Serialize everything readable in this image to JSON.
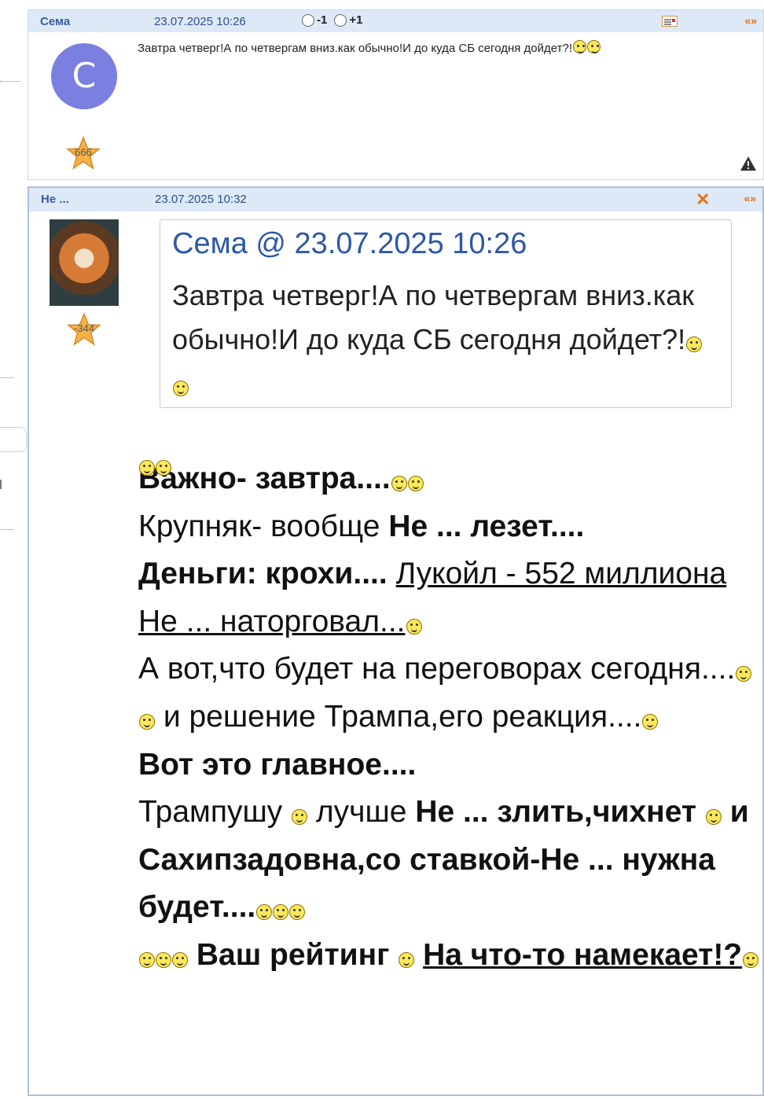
{
  "post1": {
    "author": "Сема",
    "date": "23.07.2025 10:26",
    "vote_minus": "-1",
    "vote_plus": "+1",
    "nav": "«»",
    "avatar_letter": "С",
    "rating": "666",
    "text": "Завтра четверг!А по четвергам вниз.как обычно!И до куда СБ сегодня дойдет?!"
  },
  "post2": {
    "author": "Не ...",
    "date": "23.07.2025 10:32",
    "nav": "«»",
    "rating": "-344",
    "quote": {
      "author": "Сема",
      "at": "@",
      "date": "23.07.2025 10:26",
      "text": "Завтра четверг!А по четвергам вниз.как обычно!И до куда СБ сегодня дойдет?!"
    },
    "body": {
      "l1_bold": "Важно- завтра....",
      "l2_a": "Крупняк- вообще ",
      "l2_b": "Не ... лезет....",
      "l3_bold": "Деньги: крохи....",
      "l3_link": "Лукойл - 552 миллиона Не ... наторговал...",
      "l4_a": "А вот,что будет на переговорах сегодня....",
      "l4_b": " и решение Трампа,его реакция....",
      "l5_bold": "Вот это главное....",
      "l6_a": "Трампушу ",
      "l6_b": " лучше ",
      "l6_c": "Не ... злить,чихнет",
      "l6_d": " и Сахипзадовна,со ставкой-Не ... нужна будет....",
      "l7_bold": " Ваш рейтинг ",
      "l7_link": "На что-то намекает!?"
    }
  }
}
